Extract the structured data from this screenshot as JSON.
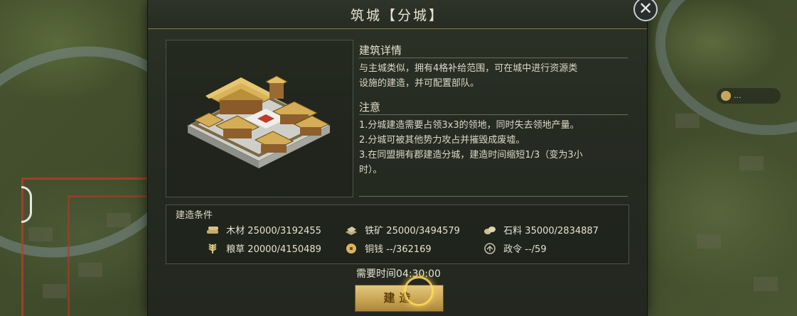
{
  "dialog": {
    "title": "筑城【分城】",
    "close": "✕"
  },
  "details": {
    "heading": "建筑详情",
    "line1": "与主城类似，拥有4格补给范围，可在城中进行资源类",
    "line2": "设施的建造，并可配置部队。"
  },
  "notes": {
    "heading": "注意",
    "line1": "1.分城建造需要占领3x3的领地，同时失去领地产量。",
    "line2": "2.分城可被其他势力攻占并摧毁成废墟。",
    "line3": "3.在同盟拥有郡建造分城，建造时间缩短1/3（变为3小",
    "line4": "时）。"
  },
  "conditions": {
    "heading": "建造条件",
    "items": [
      {
        "name": "木材",
        "value": "25000/3192455",
        "icon": "wood-icon"
      },
      {
        "name": "铁矿",
        "value": "25000/3494579",
        "icon": "iron-icon"
      },
      {
        "name": "石料",
        "value": "35000/2834887",
        "icon": "stone-icon"
      },
      {
        "name": "粮草",
        "value": "20000/4150489",
        "icon": "grain-icon"
      },
      {
        "name": "铜钱",
        "value": "--/362169",
        "icon": "copper-coin-icon"
      },
      {
        "name": "政令",
        "value": "--/59",
        "icon": "decree-icon"
      }
    ]
  },
  "time": {
    "text": "需要时间04:30:00"
  },
  "build_button": {
    "label": "建造"
  },
  "map": {
    "badge": "..."
  },
  "colors": {
    "accent_gold": "#c9a653",
    "panel": "#262b22",
    "text": "#dcd8c8"
  }
}
